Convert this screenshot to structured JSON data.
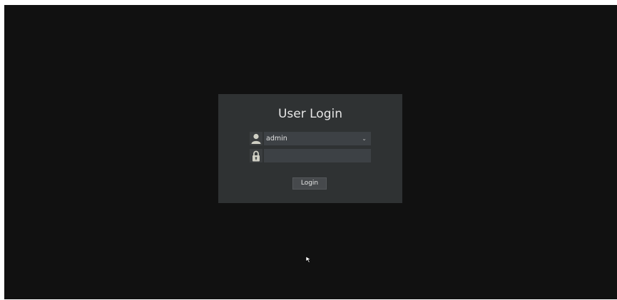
{
  "dialog": {
    "title": "User Login",
    "username": {
      "value": "admin",
      "icon": "user-icon",
      "dropdown_icon": "chevron-down-icon"
    },
    "password": {
      "value": "",
      "icon": "lock-icon"
    },
    "login_label": "Login"
  },
  "colors": {
    "background": "#111111",
    "dialog": "#2f3233",
    "field": "#3d4145",
    "text": "#e6e6e6",
    "icon": "#cfcfc4"
  }
}
